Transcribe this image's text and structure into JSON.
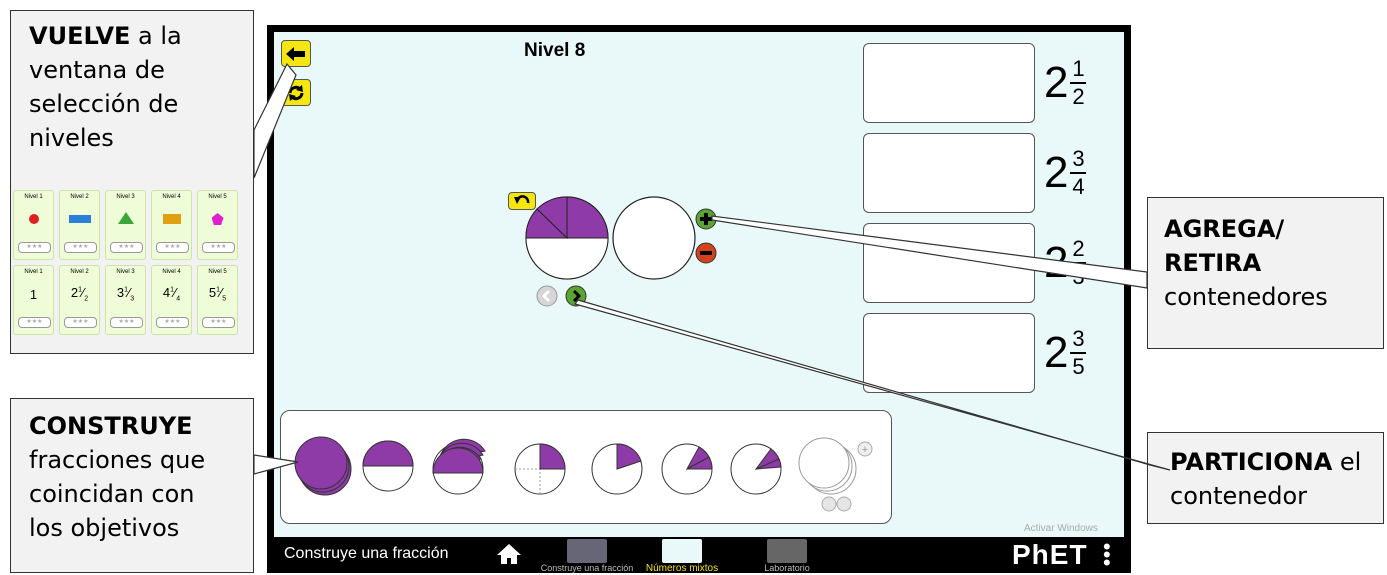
{
  "callouts": {
    "back": {
      "bold": "VUELVE",
      "rest1": " a la",
      "line2": "ventana de",
      "line3": "selección de",
      "line4": "niveles"
    },
    "build": {
      "bold": "CONSTRUYE",
      "line2": "fracciones que",
      "line3": "coincidan con",
      "line4": "los objetivos"
    },
    "add": {
      "bold1": "AGREGA/",
      "bold2": "RETIRA",
      "line3": "contenedores"
    },
    "partition": {
      "bold": "PARTICIONA",
      "rest": " el",
      "line2": "contenedor"
    }
  },
  "level_cards": {
    "row1": [
      "Nivel 1",
      "Nivel 2",
      "Nivel 3",
      "Nivel 4",
      "Nivel 5"
    ],
    "row2": [
      {
        "label": "Nivel 1",
        "whole": "1",
        "num": "",
        "den": ""
      },
      {
        "label": "Nivel 2",
        "whole": "2",
        "num": "1",
        "den": "2"
      },
      {
        "label": "Nivel 3",
        "whole": "3",
        "num": "1",
        "den": "3"
      },
      {
        "label": "Nivel 4",
        "whole": "4",
        "num": "1",
        "den": "4"
      },
      {
        "label": "Nivel 5",
        "whole": "5",
        "num": "1",
        "den": "5"
      }
    ],
    "stars": "★★★"
  },
  "sim": {
    "level_title": "Nivel 8",
    "targets": [
      {
        "whole": "2",
        "num": "1",
        "den": "2"
      },
      {
        "whole": "2",
        "num": "3",
        "den": "4"
      },
      {
        "whole": "2",
        "num": "2",
        "den": "3"
      },
      {
        "whole": "2",
        "num": "3",
        "den": "5"
      }
    ],
    "colors": {
      "piece": "#8e3ba8",
      "play_bg": "#e9f8f8",
      "button_yellow": "#f5e60f",
      "green": "#5aa531",
      "red": "#d4421b"
    }
  },
  "navbar": {
    "title": "Construye una fracción",
    "tabs": [
      "Construye una fracción",
      "Números mixtos",
      "Laboratorio"
    ],
    "watermark": "Activar Windows",
    "brand": "PhET"
  }
}
